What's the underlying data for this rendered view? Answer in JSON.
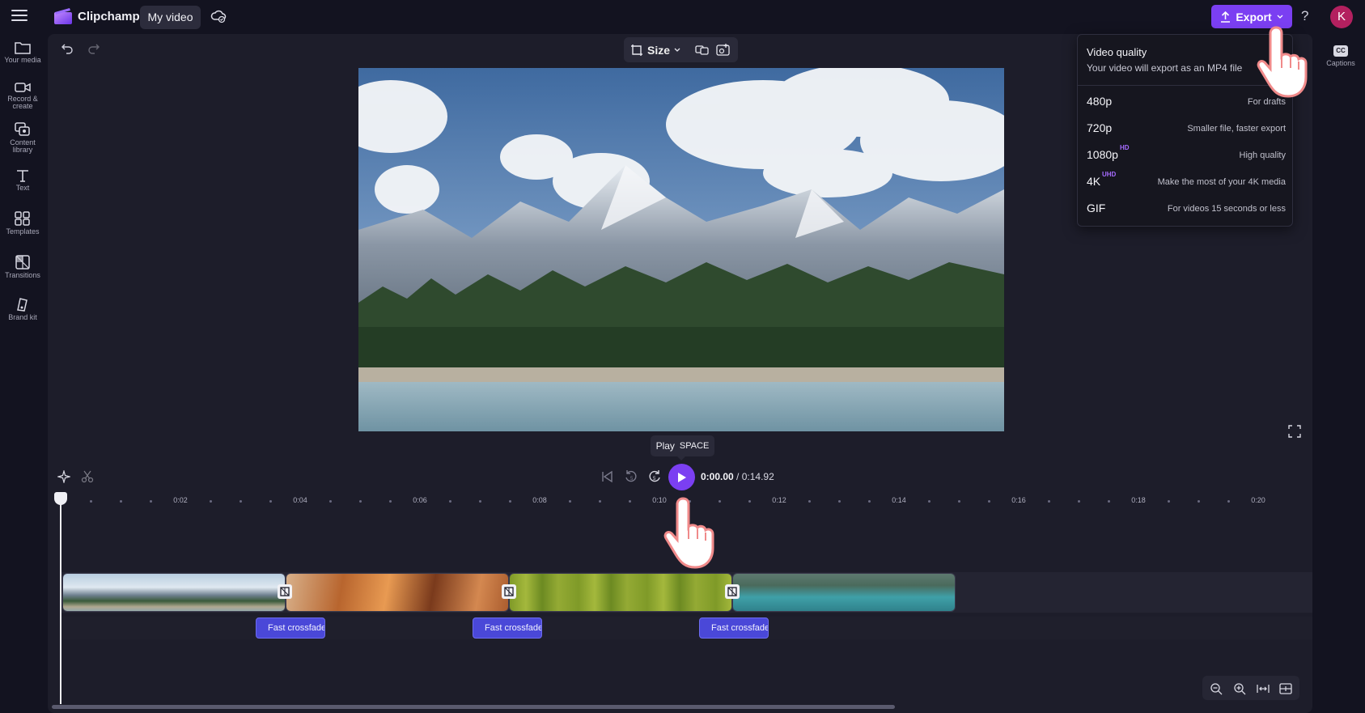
{
  "topbar": {
    "app_name": "Clipchamp",
    "project_name": "My video",
    "export_label": "Export",
    "help_label": "?",
    "avatar_initial": "K"
  },
  "left_rail": {
    "items": [
      {
        "label": "Your media",
        "icon": "folder-icon"
      },
      {
        "label": "Record &\ncreate",
        "icon": "video-camera-icon"
      },
      {
        "label": "Content\nlibrary",
        "icon": "library-icon"
      },
      {
        "label": "Text",
        "icon": "text-icon"
      },
      {
        "label": "Templates",
        "icon": "templates-icon"
      },
      {
        "label": "Transitions",
        "icon": "transitions-icon"
      },
      {
        "label": "Brand kit",
        "icon": "brand-kit-icon"
      }
    ]
  },
  "right_rail": {
    "captions_badge": "CC",
    "captions_label": "Captions"
  },
  "preview_toolbar": {
    "size_label": "Size"
  },
  "tooltip": {
    "action": "Play",
    "key": "SPACE"
  },
  "playback": {
    "current_time": "0:00.00",
    "separator": " / ",
    "total_time": "0:14.92"
  },
  "ruler": {
    "labels": [
      "0:02",
      "0:04",
      "0:06",
      "0:08",
      "0:10",
      "0:12",
      "0:14",
      "0:16",
      "0:18",
      "0:20"
    ]
  },
  "audio_clips": [
    {
      "label": "Fast crossfade"
    },
    {
      "label": "Fast crossfade"
    },
    {
      "label": "Fast crossfade"
    }
  ],
  "export_menu": {
    "title": "Video quality",
    "subtitle": "Your video will export as an MP4 file",
    "options": [
      {
        "quality": "480p",
        "badge": "",
        "description": "For drafts"
      },
      {
        "quality": "720p",
        "badge": "",
        "description": "Smaller file, faster export"
      },
      {
        "quality": "1080p",
        "badge": "HD",
        "description": "High quality"
      },
      {
        "quality": "4K",
        "badge": "UHD",
        "description": "Make the most of your 4K media"
      },
      {
        "quality": "GIF",
        "badge": "",
        "description": "For videos 15 seconds or less"
      }
    ]
  },
  "colors": {
    "accent": "#7b3ff2",
    "audio_clip": "#4a48d8",
    "background": "#131320",
    "workspace": "#1d1d2a"
  }
}
